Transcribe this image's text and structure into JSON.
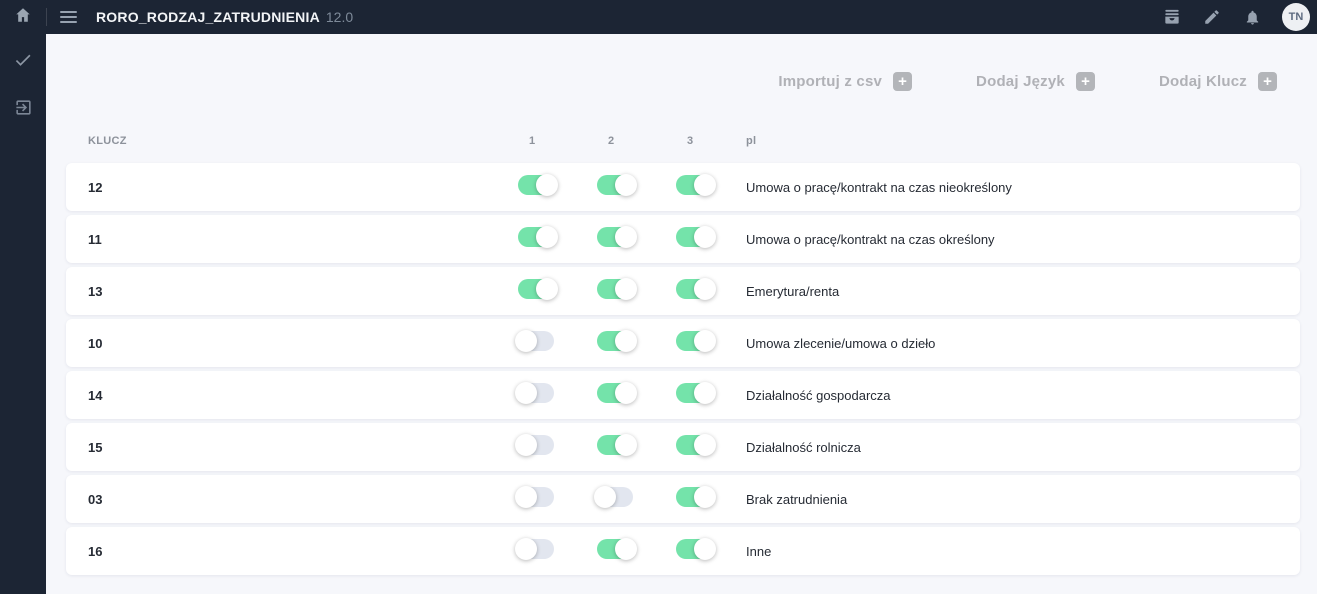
{
  "topbar": {
    "title": "RORO_RODZAJ_ZATRUDNIENIA",
    "version": "12.0",
    "avatar_initials": "TN"
  },
  "actions": {
    "import_csv": "Importuj z csv",
    "add_language": "Dodaj Język",
    "add_key": "Dodaj Klucz"
  },
  "table": {
    "columns": [
      "KLUCZ",
      "1",
      "2",
      "3",
      "pl"
    ],
    "rows": [
      {
        "klucz": "12",
        "toggles": [
          true,
          true,
          true
        ],
        "pl": "Umowa o pracę/kontrakt na czas nieokreślony"
      },
      {
        "klucz": "11",
        "toggles": [
          true,
          true,
          true
        ],
        "pl": "Umowa o pracę/kontrakt na czas określony"
      },
      {
        "klucz": "13",
        "toggles": [
          true,
          true,
          true
        ],
        "pl": "Emerytura/renta"
      },
      {
        "klucz": "10",
        "toggles": [
          false,
          true,
          true
        ],
        "pl": "Umowa zlecenie/umowa o dzieło"
      },
      {
        "klucz": "14",
        "toggles": [
          false,
          true,
          true
        ],
        "pl": "Działalność gospodarcza"
      },
      {
        "klucz": "15",
        "toggles": [
          false,
          true,
          true
        ],
        "pl": "Działalność rolnicza"
      },
      {
        "klucz": "03",
        "toggles": [
          false,
          false,
          true
        ],
        "pl": "Brak zatrudnienia"
      },
      {
        "klucz": "16",
        "toggles": [
          false,
          true,
          true
        ],
        "pl": "Inne"
      }
    ]
  },
  "icons": {
    "topbar_left": [
      "home-icon",
      "menu-icon"
    ],
    "topbar_right": [
      "inbox-icon",
      "edit-pencil-icon",
      "notifications-bell-icon"
    ],
    "sidebar": [
      "check-icon",
      "exit-to-app-icon"
    ],
    "action_suffix": "plus-icon"
  },
  "colors": {
    "topbar_bg": "#1c2534",
    "content_bg": "#f6f7fb",
    "toggle_on": "#74e3aa",
    "toggle_off": "#e2e6ef",
    "action_gray": "#b0b1b6",
    "icon_gray": "#97a2b0",
    "header_text": "#8d929b",
    "row_text": "#262b34"
  }
}
